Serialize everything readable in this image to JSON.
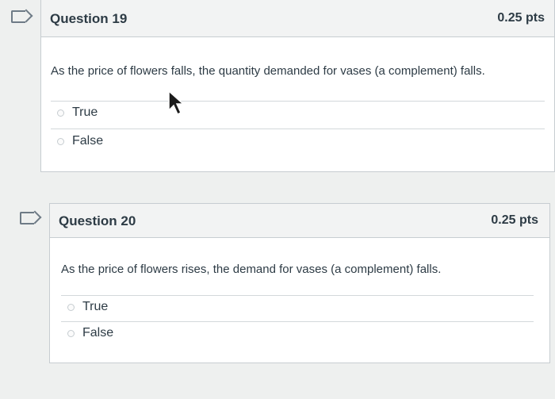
{
  "questions": [
    {
      "title": "Question 19",
      "points": "0.25 pts",
      "text": "As the price of flowers falls, the quantity demanded for vases (a complement) falls.",
      "answers": [
        {
          "label": "True"
        },
        {
          "label": "False"
        }
      ]
    },
    {
      "title": "Question 20",
      "points": "0.25 pts",
      "text": "As the price of flowers rises, the demand for vases (a complement) falls.",
      "answers": [
        {
          "label": "True"
        },
        {
          "label": "False"
        }
      ]
    }
  ],
  "icons": {
    "flag": "flag-icon",
    "radio": "radio-button-icon",
    "cursor": "mouse-pointer-icon"
  }
}
